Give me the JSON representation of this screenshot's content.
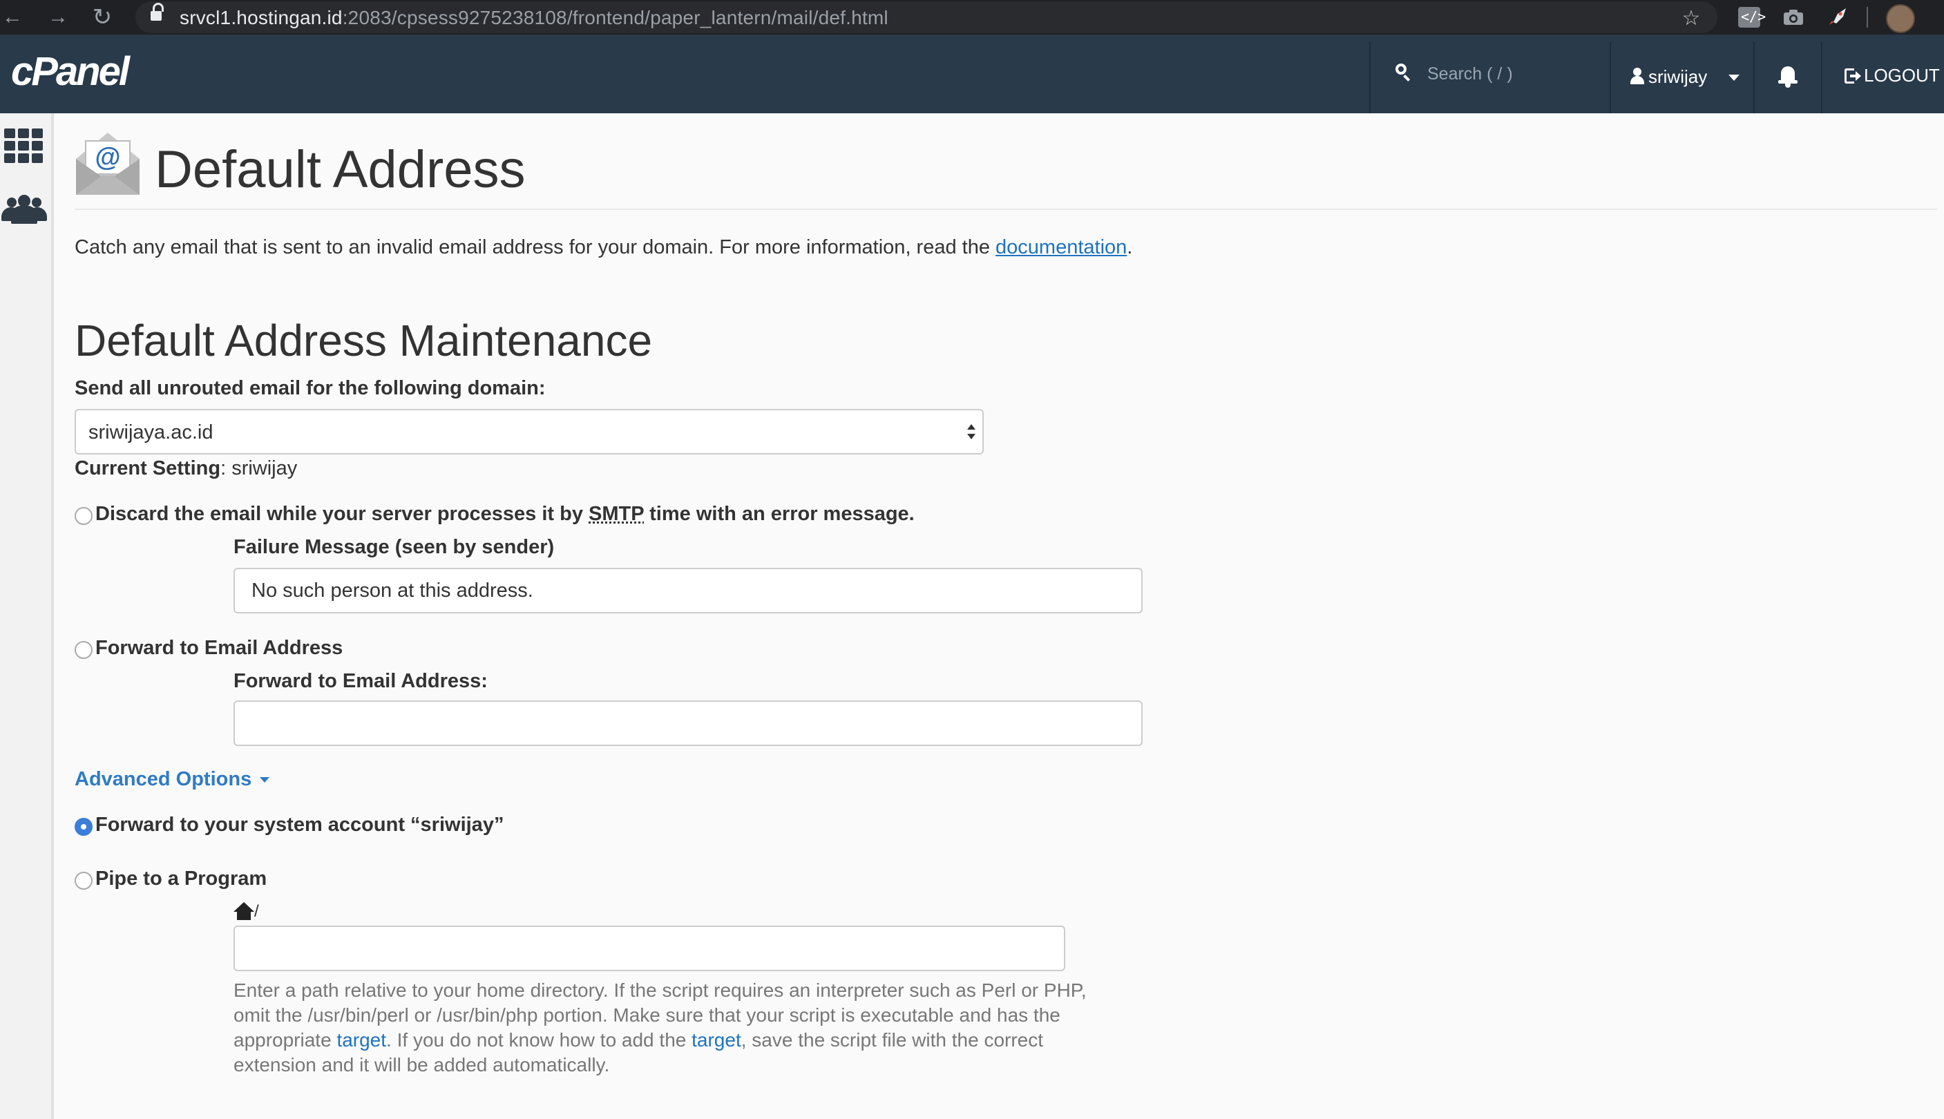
{
  "browser": {
    "url_host": "srvcl1.hostingan.id",
    "url_path": ":2083/cpsess9275238108/frontend/paper_lantern/mail/def.html",
    "icons": [
      "back-icon",
      "forward-icon",
      "reload-icon",
      "lock-icon",
      "star-icon",
      "extension-code-icon",
      "camera-icon",
      "rocket-icon",
      "profile-avatar-icon"
    ]
  },
  "header": {
    "logo": "cPanel",
    "search_placeholder": "Search ( / )",
    "username": "sriwijay",
    "logout_label": "LOGOUT",
    "bg_color": "#293a4a"
  },
  "page": {
    "title": "Default Address",
    "description_text": "Catch any email that is sent to an invalid email address for your domain. For more information, read the ",
    "documentation_link": "documentation",
    "description_end": ".",
    "section_title": "Default Address Maintenance",
    "domain_label": "Send all unrouted email for the following domain:",
    "domain_selected": "sriwijaya.ac.id",
    "current_setting_label": "Current Setting",
    "current_setting_sep": ":",
    "current_setting_value": "sriwijay"
  },
  "options": {
    "discard_pre": "Discard the email while your server processes it by ",
    "discard_abbr": "SMTP",
    "discard_post": " time with an error message.",
    "failure_label": "Failure Message (seen by sender)",
    "failure_value": "No such person at this address.",
    "forward_email_label": "Forward to Email Address",
    "forward_email_field_label": "Forward to Email Address:",
    "forward_email_value": "",
    "advanced_label": "Advanced Options",
    "system_account_label": "Forward to your system account “sriwijay”",
    "pipe_label": "Pipe to a Program",
    "pipe_prefix": "/",
    "pipe_value": "",
    "selected": "system_account"
  },
  "help": {
    "part1": "Enter a path relative to your home directory. If the script requires an interpreter such as Perl or PHP, omit the /usr/bin/perl or /usr/bin/php portion. Make sure that your script is executable and has the appropriate ",
    "link1": "target",
    "part2": ". If you do not know how to add the ",
    "link2": "target",
    "part3": ", save the script file with the correct extension and it will be added automatically."
  },
  "colors": {
    "accent_blue": "#2f7bc4",
    "link_blue": "#1e73be",
    "radio_checked": "#3b7dd8"
  }
}
